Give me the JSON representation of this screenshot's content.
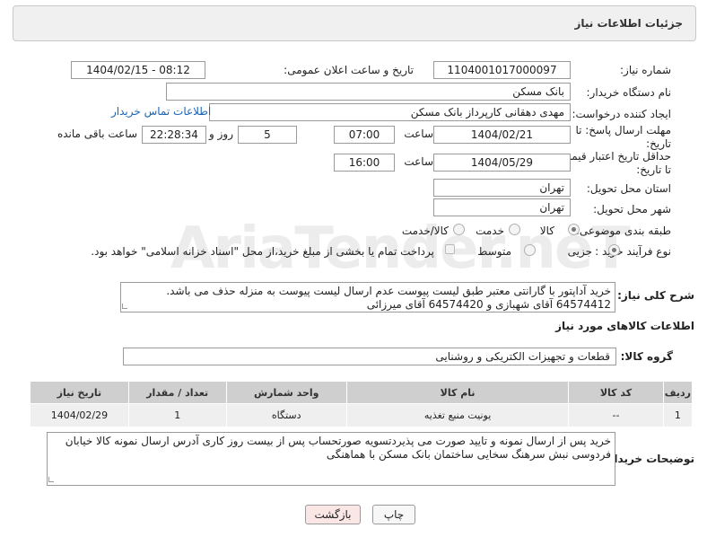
{
  "header": {
    "title": "جزئیات اطلاعات نیاز"
  },
  "form": {
    "need_number_label": "شماره نیاز:",
    "need_number": "1104001017000097",
    "announce_label": "تاریخ و ساعت اعلان عمومی:",
    "announce_value": "1404/02/15 - 08:12",
    "buyer_label": "نام دستگاه خریدار:",
    "buyer_value": "بانک مسکن",
    "creator_label": "ایجاد کننده درخواست:",
    "creator_value": "مهدی دهقانی کارپرداز بانک مسکن",
    "contact_link": "اطلاعات تماس خریدار",
    "reply_label_1": "مهلت ارسال پاسخ: تا",
    "reply_label_2": "تاریخ:",
    "reply_date": "1404/02/21",
    "time_label": "ساعت",
    "reply_time": "07:00",
    "reply_days": "5",
    "days_label": "روز و",
    "reply_remaining": "22:28:34",
    "remaining_label": "ساعت باقی مانده",
    "price_label_1": "حداقل تاریخ اعتبار قیمت:",
    "price_label_2": "تا تاریخ:",
    "price_date": "1404/05/29",
    "price_time": "16:00",
    "province_label": "استان محل تحویل:",
    "province_value": "تهران",
    "city_label": "شهر محل تحویل:",
    "city_value": "تهران",
    "category_label": "طبقه بندی موضوعی:",
    "category_options": [
      "کالا",
      "خدمت",
      "کالا/خدمت"
    ],
    "process_label": "نوع فرآیند خرید :",
    "process_options": [
      "جزیی",
      "متوسط"
    ],
    "payment_note": "پرداخت تمام یا بخشی از مبلغ خرید،از محل \"اسناد خزانه اسلامی\" خواهد بود."
  },
  "description": {
    "label": "شرح کلی نیاز:",
    "text": "خرید آداپتور با گارانتی معتبر طبق لیست پیوست عدم ارسال لیست پیوست به منزله حذف می باشد.\n64574412 آقای شهبازی و 64574420 آقای میرزائی"
  },
  "goods": {
    "section_title": "اطلاعات کالاهای مورد نیاز",
    "group_label": "گروه کالا:",
    "group_value": "قطعات و تجهیزات الکتریکی و روشنایی",
    "columns": [
      "ردیف",
      "کد کالا",
      "نام کالا",
      "واحد شمارش",
      "تعداد / مقدار",
      "تاریخ نیاز"
    ],
    "rows": [
      [
        "1",
        "--",
        "یونیت منبع تغذیه",
        "دستگاه",
        "1",
        "1404/02/29"
      ]
    ]
  },
  "buyer_notes": {
    "label": "توضیحات خریدار:",
    "text": "خرید پس از ارسال نمونه و تایید صورت می پذیردتسویه صورتحساب پس از بیست روز کاری آدرس ارسال نمونه کالا خیابان فردوسی نبش سرهنگ سخایی ساختمان بانک مسکن با هماهنگی"
  },
  "buttons": {
    "print": "چاپ",
    "back": "بازگشت"
  },
  "watermark": "AriaTender.neT",
  "colors": {
    "link": "#1a64b4",
    "back_button": "#fbe6e6",
    "panel": "#f0f0f0",
    "table_header": "#cfcfcf"
  }
}
